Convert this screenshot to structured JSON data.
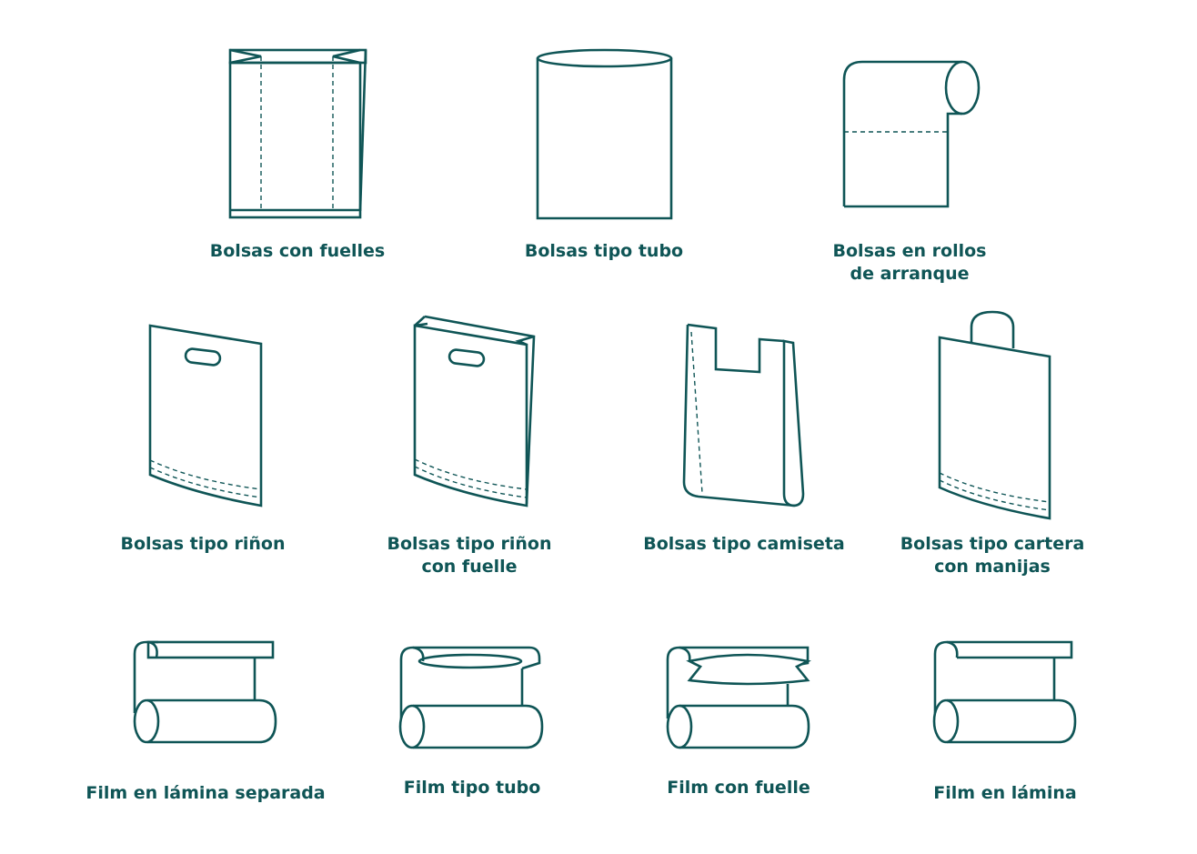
{
  "colors": {
    "ink": "#0f5556",
    "background": "#ffffff"
  },
  "items": [
    {
      "label": "Bolsas con fuelles",
      "icon": "gusseted-bag-icon"
    },
    {
      "label": "Bolsas tipo tubo",
      "icon": "tube-bag-icon"
    },
    {
      "label": "Bolsas en rollos\nde arranque",
      "icon": "roll-bag-icon"
    },
    {
      "label": "Bolsas tipo riñon",
      "icon": "die-cut-bag-icon"
    },
    {
      "label": "Bolsas tipo riñon\ncon fuelle",
      "icon": "die-cut-gusset-bag-icon"
    },
    {
      "label": "Bolsas tipo camiseta",
      "icon": "t-shirt-bag-icon"
    },
    {
      "label": "Bolsas tipo cartera\ncon manijas",
      "icon": "loop-handle-bag-icon"
    },
    {
      "label": "Film en lámina separada",
      "icon": "separated-sheet-film-icon"
    },
    {
      "label": "Film tipo tubo",
      "icon": "tube-film-icon"
    },
    {
      "label": "Film con fuelle",
      "icon": "gusseted-film-icon"
    },
    {
      "label": "Film en lámina",
      "icon": "sheet-film-icon"
    }
  ]
}
